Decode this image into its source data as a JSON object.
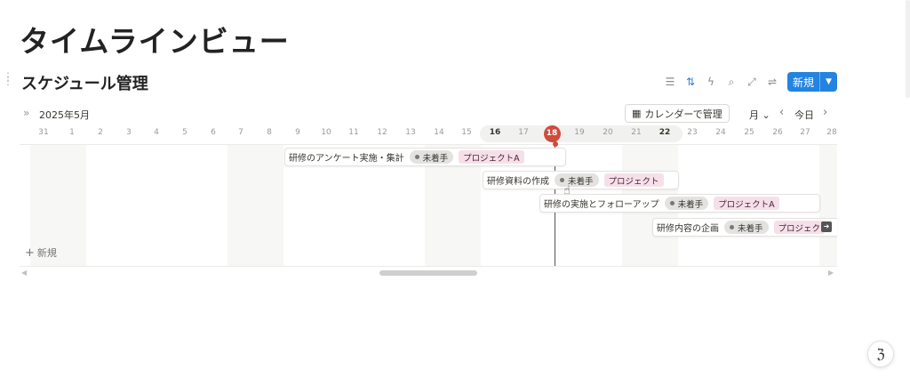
{
  "page": {
    "title": "タイムラインビュー"
  },
  "database": {
    "title": "スケジュール管理"
  },
  "toolbar": {
    "icons": [
      "filter-icon",
      "sort-icon",
      "lightning-icon",
      "search-icon",
      "expand-icon",
      "settings-icon"
    ],
    "new_label": "新規"
  },
  "timeline": {
    "month_label": "2025年5月",
    "calendar_button": "カレンダーで管理",
    "period_label": "月",
    "today_label": "今日",
    "today_date": "18",
    "dates": [
      "31",
      "1",
      "2",
      "3",
      "4",
      "5",
      "6",
      "7",
      "8",
      "9",
      "10",
      "11",
      "12",
      "13",
      "14",
      "15",
      "16",
      "17",
      "18",
      "19",
      "20",
      "21",
      "22",
      "23",
      "24",
      "25",
      "26",
      "27",
      "28"
    ],
    "add_label": "新規"
  },
  "tasks": [
    {
      "title": "研修のアンケート実施・集計",
      "status": "未着手",
      "tag": "プロジェクトA"
    },
    {
      "title": "研修資料の作成",
      "status": "未着手",
      "tag": "プロジェクト"
    },
    {
      "title": "研修の実施とフォローアップ",
      "status": "未着手",
      "tag": "プロジェクトA"
    },
    {
      "title": "研修内容の企画",
      "status": "未着手",
      "tag": "プロジェク"
    }
  ],
  "colors": {
    "accent": "#2383e2",
    "today": "#cf4b3c",
    "status_bg": "#e3e2e0",
    "tag_bg": "#f5e0e9"
  }
}
